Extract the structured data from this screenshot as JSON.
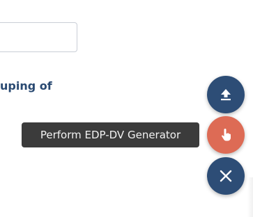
{
  "form": {
    "input_value": "",
    "heading_fragment": "uping of"
  },
  "fab_menu": {
    "upload_icon": "upload-icon",
    "perform_icon": "hand-pointer-icon",
    "close_icon": "close-icon",
    "tooltip_text": "Perform EDP-DV Generator",
    "primary_color": "#2d4d76",
    "accent_color": "#dd6b55"
  }
}
